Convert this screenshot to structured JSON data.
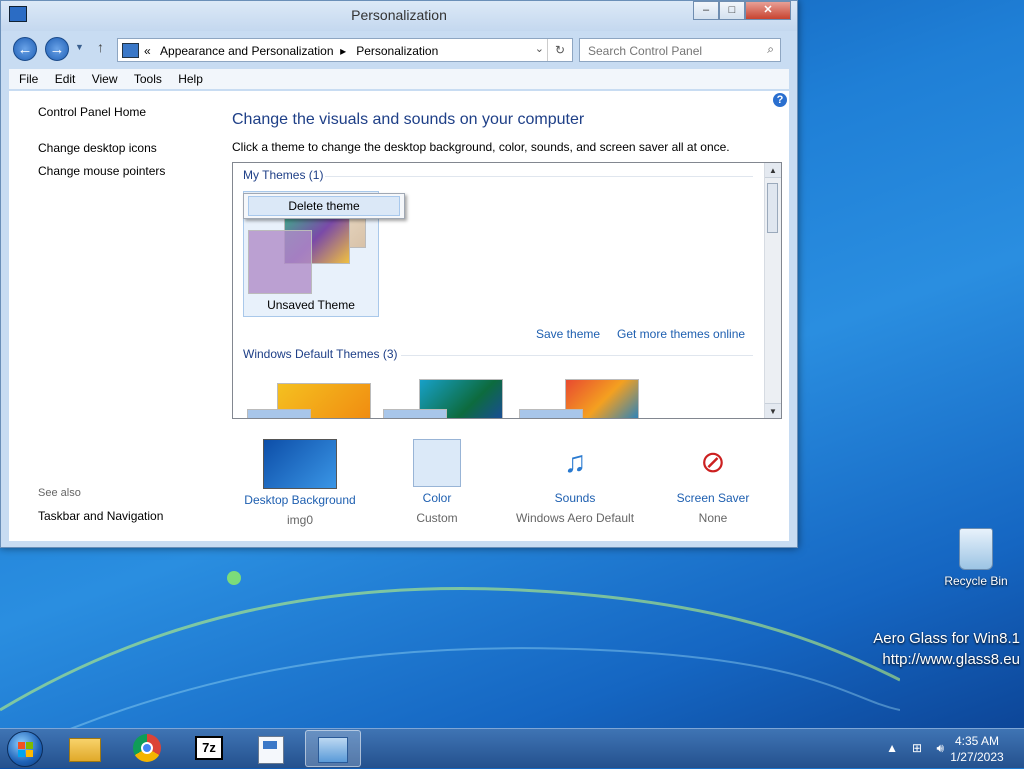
{
  "window": {
    "title": "Personalization",
    "buttons": {
      "minimize": "–",
      "maximize": "□",
      "close": "✕"
    }
  },
  "navbar": {
    "back": "←",
    "forward": "→",
    "up": "↑",
    "breadcrumb": [
      "Appearance and Personalization",
      "Personalization"
    ],
    "breadcrumb_overflow": "«",
    "search_placeholder": "Search Control Panel"
  },
  "menu": [
    "File",
    "Edit",
    "View",
    "Tools",
    "Help"
  ],
  "left_nav": {
    "home": "Control Panel Home",
    "desktop_icons": "Change desktop icons",
    "mouse_pointers": "Change mouse pointers",
    "see_also_label": "See also",
    "taskbar_nav": "Taskbar and Navigation"
  },
  "main": {
    "heading": "Change the visuals and sounds on your computer",
    "subheading": "Click a theme to change the desktop background, color, sounds, and screen saver all at once.",
    "my_themes_label": "My Themes (1)",
    "context_menu_item": "Delete theme",
    "unsaved_theme": "Unsaved Theme",
    "save_theme": "Save theme",
    "get_more": "Get more themes online",
    "default_themes_label": "Windows Default Themes (3)"
  },
  "bottom": [
    {
      "label": "Desktop Background",
      "value": "img0",
      "icon": "desktop-background-icon"
    },
    {
      "label": "Color",
      "value": "Custom",
      "icon": "color-swatch-icon"
    },
    {
      "label": "Sounds",
      "value": "Windows Aero Default",
      "icon": "sounds-icon"
    },
    {
      "label": "Screen Saver",
      "value": "None",
      "icon": "screen-saver-icon"
    }
  ],
  "desktop": {
    "recycle_bin": "Recycle Bin",
    "watermark_line1": "Aero Glass for Win8.1",
    "watermark_line2": "http://www.glass8.eu"
  },
  "taskbar": {
    "time": "4:35 AM",
    "date": "1/27/2023",
    "apps": [
      "file-explorer-icon",
      "chrome-icon",
      "7zip-icon",
      "document-viewer-icon",
      "control-panel-icon"
    ]
  },
  "colors": {
    "accent": "#1e3f87",
    "link": "#1e5fb0"
  }
}
